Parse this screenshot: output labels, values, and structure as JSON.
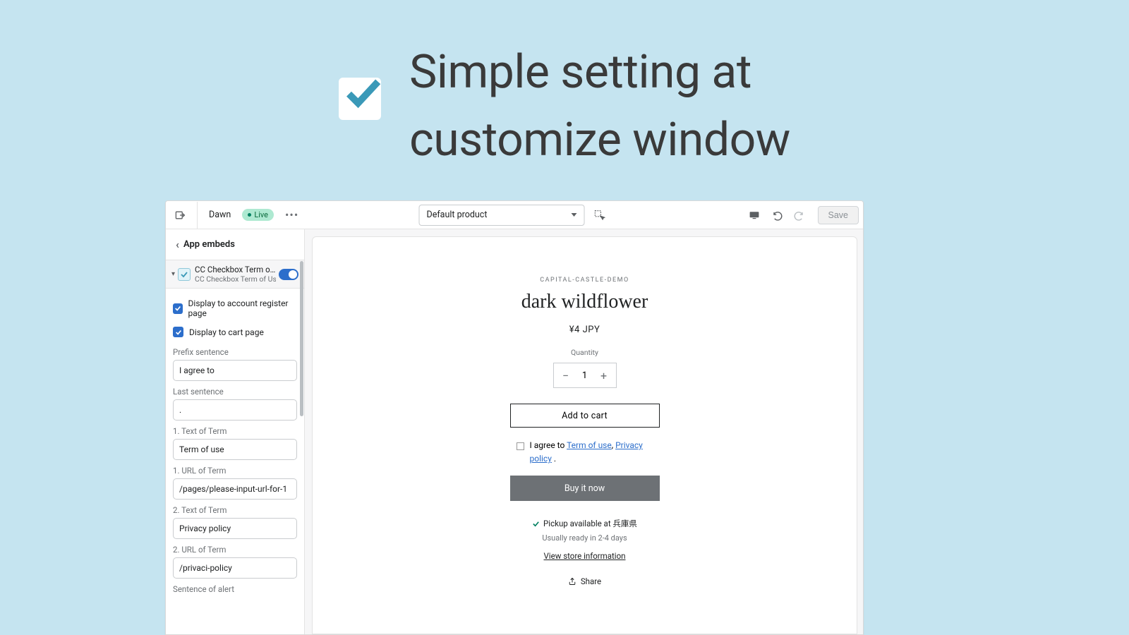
{
  "hero": {
    "headline_line1": "Simple setting at",
    "headline_line2": "customize window"
  },
  "topbar": {
    "theme_name": "Dawn",
    "live_badge": "Live",
    "template": "Default product",
    "save_label": "Save"
  },
  "sidebar": {
    "header": "App embeds",
    "embed": {
      "title": "CC Checkbox Term of…",
      "subtitle": "CC Checkbox Term of Use"
    },
    "check1_label": "Display to account register page",
    "check2_label": "Display to cart page",
    "fields": [
      {
        "label": "Prefix sentence",
        "value": "I agree to"
      },
      {
        "label": "Last sentence",
        "value": "."
      },
      {
        "label": "1. Text of Term",
        "value": "Term of use"
      },
      {
        "label": "1. URL of Term",
        "value": "/pages/please-input-url-for-1"
      },
      {
        "label": "2. Text of Term",
        "value": "Privacy policy"
      },
      {
        "label": "2. URL of Term",
        "value": "/privaci-policy"
      }
    ],
    "partial_label": "Sentence of alert"
  },
  "preview": {
    "brand": "CAPITAL-CASTLE-DEMO",
    "product_title": "dark wildflower",
    "price": "¥4 JPY",
    "quantity_label": "Quantity",
    "quantity_value": "1",
    "add_to_cart": "Add to cart",
    "agree_prefix": "I agree to ",
    "term1": "Term of use",
    "sep": ", ",
    "term2": "Privacy policy",
    "agree_suffix": " .",
    "buy_now": "Buy it now",
    "pickup_text": "Pickup available at 兵庫県",
    "pickup_ready": "Usually ready in 2-4 days",
    "store_info": "View store information",
    "share": "Share"
  }
}
